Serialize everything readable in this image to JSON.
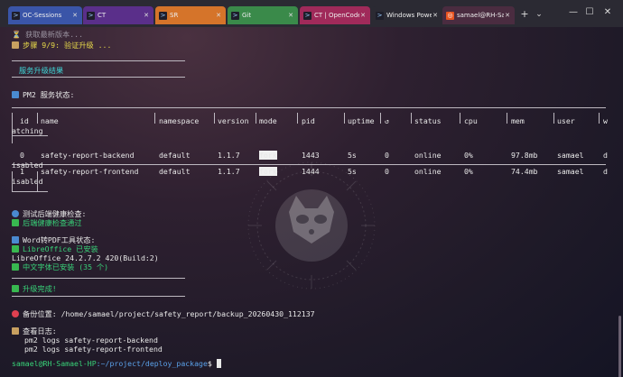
{
  "tabs": [
    {
      "label": "OC-Sessions",
      "color": "#3a55a8"
    },
    {
      "label": "CT",
      "color": "#5a2f8a"
    },
    {
      "label": "SR",
      "color": "#d5742a"
    },
    {
      "label": "Git",
      "color": "#3a8a4a"
    },
    {
      "label": "CT | OpenCode",
      "color": "#a02a5a"
    },
    {
      "label": "Windows PowerSh",
      "color": "#2b2a33"
    },
    {
      "label": "samael@RH-Sam",
      "color": "#4a2c40"
    }
  ],
  "tabbar_buttons": {
    "new": "+",
    "dropdown": "⌄"
  },
  "window_controls": {
    "minimize": "—",
    "maximize": "☐",
    "close": "✕"
  },
  "terminal": {
    "line_top": "⏳ 获取最新版本...",
    "step": "步骤 9/9: 验证升级 ...",
    "heading": "服务升级结果",
    "pm2_status": "PM2 服务状态:",
    "table": {
      "headers": [
        "id",
        "name",
        "namespace",
        "version",
        "mode",
        "pid",
        "uptime",
        "↺",
        "status",
        "cpu",
        "mem",
        "user",
        "w"
      ],
      "header_wrap": "atching",
      "rows": [
        {
          "id": "0",
          "name": "safety-report-backend",
          "namespace": "default",
          "version": "1.1.7",
          "mode": "fork",
          "pid": "1443",
          "uptime": "5s",
          "restarts": "0",
          "status": "online",
          "cpu": "0%",
          "mem": "97.8mb",
          "user": "samael",
          "w": "d",
          "wrap": "isabled"
        },
        {
          "id": "1",
          "name": "safety-report-frontend",
          "namespace": "default",
          "version": "1.1.7",
          "mode": "fork",
          "pid": "1444",
          "uptime": "5s",
          "restarts": "0",
          "status": "online",
          "cpu": "0%",
          "mem": "74.4mb",
          "user": "samael",
          "w": "d",
          "wrap": "isabled"
        }
      ]
    },
    "health_title": "测试后端健康检查:",
    "health_ok": "后端健康检查通过",
    "word_title": "Word转PDF工具状态:",
    "lo_installed": "LibreOffice 已安装",
    "lo_version": "LibreOffice 24.2.7.2 420(Build:2)",
    "fonts": "中文字体已安装 (35 个)",
    "done": "升级完成!",
    "backup": "备份位置: /home/samael/project/safety_report/backup_20260430_112137",
    "logs_title": "查看日志:",
    "log1": "pm2 logs safety-report-backend",
    "log2": "pm2 logs safety-report-frontend",
    "prompt_user": "samael@RH-Samael-HP",
    "prompt_path": ":~/project/deploy_package",
    "prompt_sym": "$"
  }
}
